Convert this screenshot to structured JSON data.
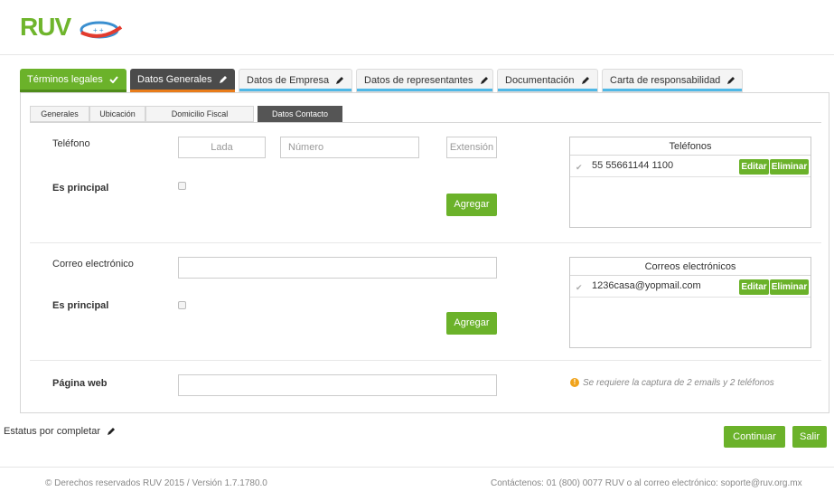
{
  "brand": {
    "logo_text": "RUV"
  },
  "tabs": [
    {
      "label": "Términos legales"
    },
    {
      "label": "Datos Generales"
    },
    {
      "label": "Datos de Empresa"
    },
    {
      "label": "Datos de representantes"
    },
    {
      "label": "Documentación"
    },
    {
      "label": "Carta de responsabilidad"
    }
  ],
  "subtabs": [
    {
      "label": "Generales"
    },
    {
      "label": "Ubicación"
    },
    {
      "label": "Domicilio Fiscal"
    },
    {
      "label": "Datos Contacto"
    }
  ],
  "phone": {
    "label": "Teléfono",
    "lada_placeholder": "Lada",
    "numero_placeholder": "Número",
    "extension_placeholder": "Extensión",
    "principal_label": "Es principal",
    "add_label": "Agregar"
  },
  "phones_table": {
    "title": "Teléfonos",
    "rows": [
      {
        "value": "55 55661144 1100"
      }
    ],
    "edit_label": "Editar",
    "delete_label": "Eliminar"
  },
  "email": {
    "label": "Correo electrónico",
    "principal_label": "Es principal",
    "add_label": "Agregar"
  },
  "emails_table": {
    "title": "Correos electrónicos",
    "rows": [
      {
        "value": "1236casa@yopmail.com"
      }
    ],
    "edit_label": "Editar",
    "delete_label": "Eliminar"
  },
  "web": {
    "label": "Página web"
  },
  "note": "Se requiere la captura de 2 emails y 2 teléfonos",
  "status": "Estatus por completar",
  "actions": {
    "continue_label": "Continuar",
    "exit_label": "Salir"
  },
  "footer": {
    "left": "© Derechos reservados RUV 2015 / Versión 1.7.1780.0",
    "right": "Contáctenos: 01 (800) 0077 RUV o al correo electrónico: soporte@ruv.org.mx"
  },
  "colors": {
    "accent_green": "#6bb22a",
    "dark_tab": "#4b4b4b",
    "orange": "#e97c1a",
    "blue_line": "#4fb8e6"
  }
}
